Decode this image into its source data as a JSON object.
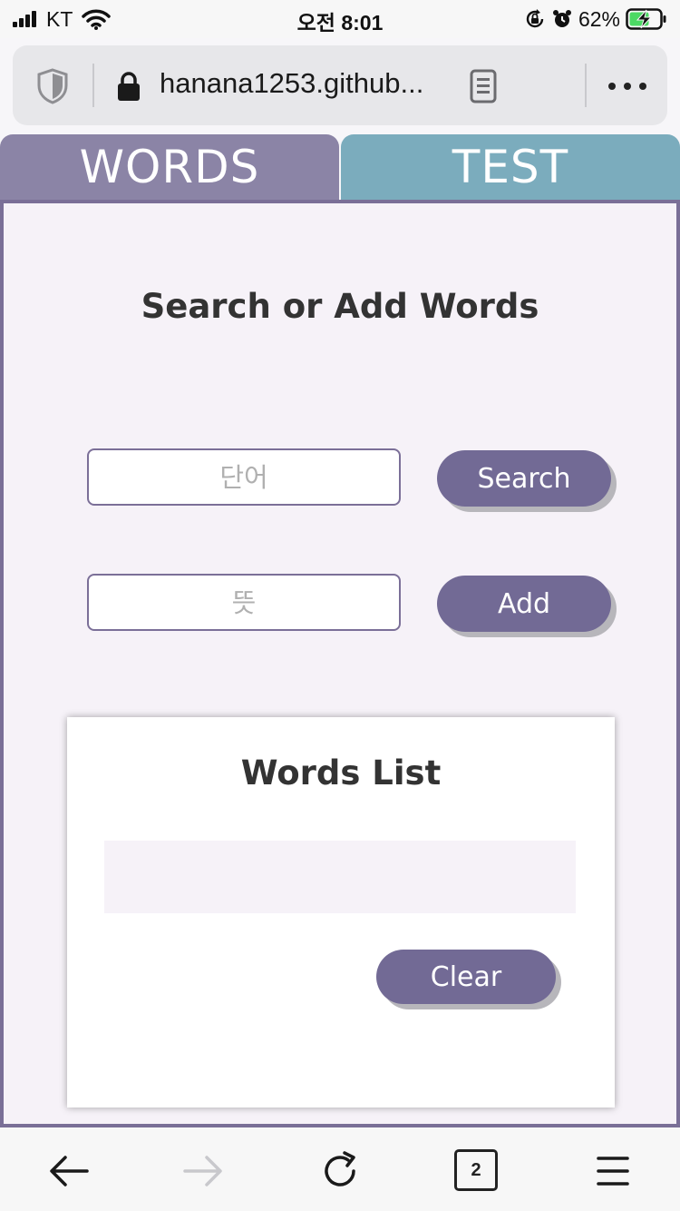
{
  "status_bar": {
    "carrier": "KT",
    "time": "오전 8:01",
    "battery_percent": "62%"
  },
  "browser": {
    "url": "hanana1253.github...",
    "open_tabs": "2",
    "icons": [
      "shield-icon",
      "lock-icon",
      "reader-mode-icon",
      "more-icon",
      "back-icon",
      "forward-icon",
      "reload-icon",
      "tabs-icon",
      "menu-icon"
    ]
  },
  "tabs": {
    "words": "WORDS",
    "test": "TEST"
  },
  "main": {
    "title": "Search or Add Words",
    "word_placeholder": "단어",
    "meaning_placeholder": "뜻",
    "search_label": "Search",
    "add_label": "Add"
  },
  "words_list": {
    "title": "Words List",
    "items": [],
    "clear_label": "Clear"
  },
  "colors": {
    "words_tab": "#8b84a6",
    "test_tab": "#7bacbd",
    "button": "#726a95",
    "panel_bg": "#f6f2f8",
    "panel_border": "#7a6f97"
  }
}
